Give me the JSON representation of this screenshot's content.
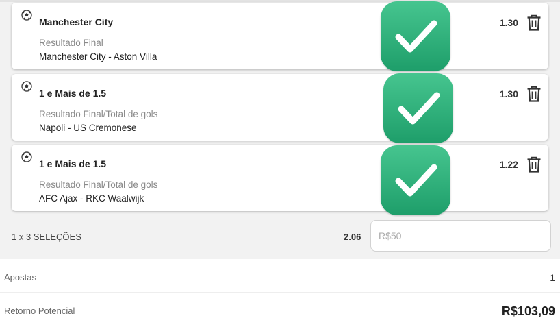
{
  "selections": [
    {
      "title": "Manchester City",
      "market": "Resultado Final",
      "match": "Manchester City - Aston Villa",
      "odd": "1.30"
    },
    {
      "title": "1 e Mais de 1.5",
      "market": "Resultado Final/Total de gols",
      "match": "Napoli - US Cremonese",
      "odd": "1.30"
    },
    {
      "title": "1 e Mais de 1.5",
      "market": "Resultado Final/Total de gols",
      "match": "AFC Ajax - RKC Waalwijk",
      "odd": "1.22"
    }
  ],
  "summary": {
    "selections_label": "1 x 3 SELEÇÕES",
    "total_odd": "2.06",
    "stake_placeholder": "R$50"
  },
  "details": {
    "bets_label": "Apostas",
    "bets_value": "1",
    "return_label": "Retorno Potencial",
    "return_value": "R$103,09"
  },
  "colors": {
    "check_green": "#2eb07a",
    "background": "#f2f2f2"
  },
  "icons": {
    "sport": "soccer-ball-icon",
    "delete": "trash-icon",
    "overlay": "check-mark-icon"
  }
}
